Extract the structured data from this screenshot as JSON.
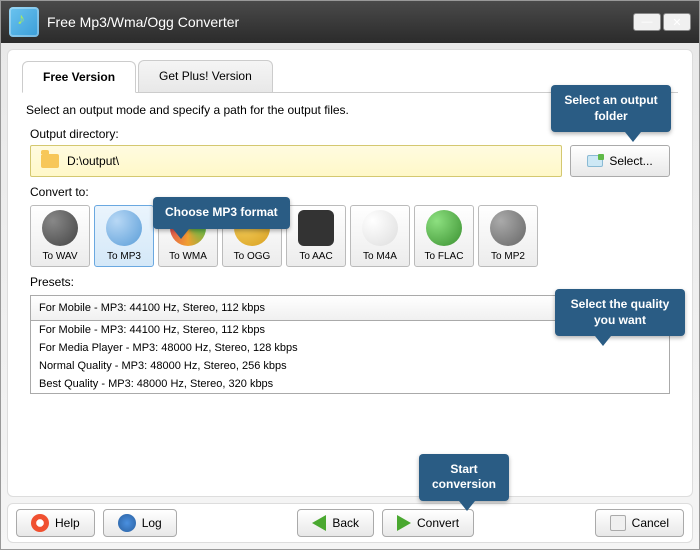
{
  "titlebar": {
    "title": "Free Mp3/Wma/Ogg Converter"
  },
  "tabs": {
    "free": "Free Version",
    "plus": "Get Plus! Version"
  },
  "instruction": "Select an output mode and specify a path for the output files.",
  "output": {
    "label": "Output directory:",
    "path": "D:\\output\\",
    "select_btn": "Select..."
  },
  "convert": {
    "label": "Convert to:",
    "formats": [
      "To WAV",
      "To MP3",
      "To WMA",
      "To OGG",
      "To AAC",
      "To M4A",
      "To FLAC",
      "To MP2"
    ]
  },
  "presets": {
    "label": "Presets:",
    "selected": "For Mobile - MP3: 44100 Hz, Stereo, 112 kbps",
    "options": [
      "For Mobile - MP3: 44100 Hz, Stereo, 112 kbps",
      "For Media Player - MP3: 48000 Hz, Stereo, 128 kbps",
      "Normal Quality - MP3: 48000 Hz, Stereo, 256 kbps",
      "Best Quality - MP3: 48000 Hz, Stereo, 320 kbps"
    ]
  },
  "buttons": {
    "help": "Help",
    "log": "Log",
    "back": "Back",
    "convert": "Convert",
    "cancel": "Cancel"
  },
  "callouts": {
    "c1": "Select an output folder",
    "c2": "Choose MP3 format",
    "c3": "Select the quality you want",
    "c4": "Start conversion"
  }
}
